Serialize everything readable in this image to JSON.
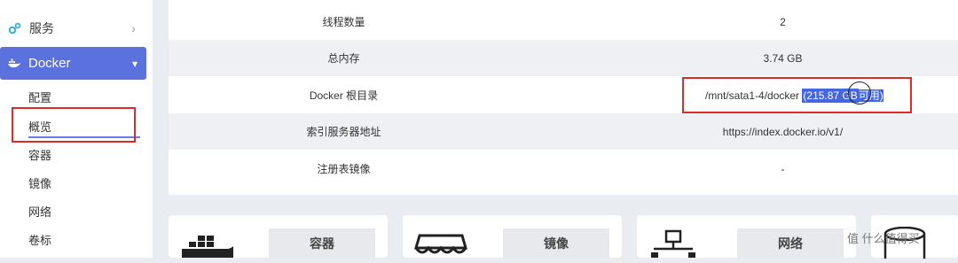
{
  "sidebar": {
    "services_label": "服务",
    "docker_label": "Docker",
    "subitems": [
      "配置",
      "概览",
      "容器",
      "镜像",
      "网络",
      "卷标"
    ]
  },
  "info_table": {
    "rows": [
      {
        "key": "线程数量",
        "value": "2"
      },
      {
        "key": "总内存",
        "value": "3.74 GB"
      },
      {
        "key": "Docker 根目录",
        "value_path": "/mnt/sata1-4/docker",
        "value_avail": "(215.87 GB",
        "value_avail_suffix": "可用)"
      },
      {
        "key": "索引服务器地址",
        "value": "https://index.docker.io/v1/"
      },
      {
        "key": "注册表镜像",
        "value": "-"
      }
    ]
  },
  "cards": [
    {
      "label": "容器",
      "icon": "docker-whale-icon"
    },
    {
      "label": "镜像",
      "icon": "awning-icon"
    },
    {
      "label": "网络",
      "icon": "network-icon"
    },
    {
      "label": "",
      "icon": "database-icon"
    }
  ],
  "watermark": "值 什么值得买",
  "colors": {
    "accent": "#5b72de",
    "highlight": "#4466e0",
    "annotation_red": "#e02a2a"
  }
}
